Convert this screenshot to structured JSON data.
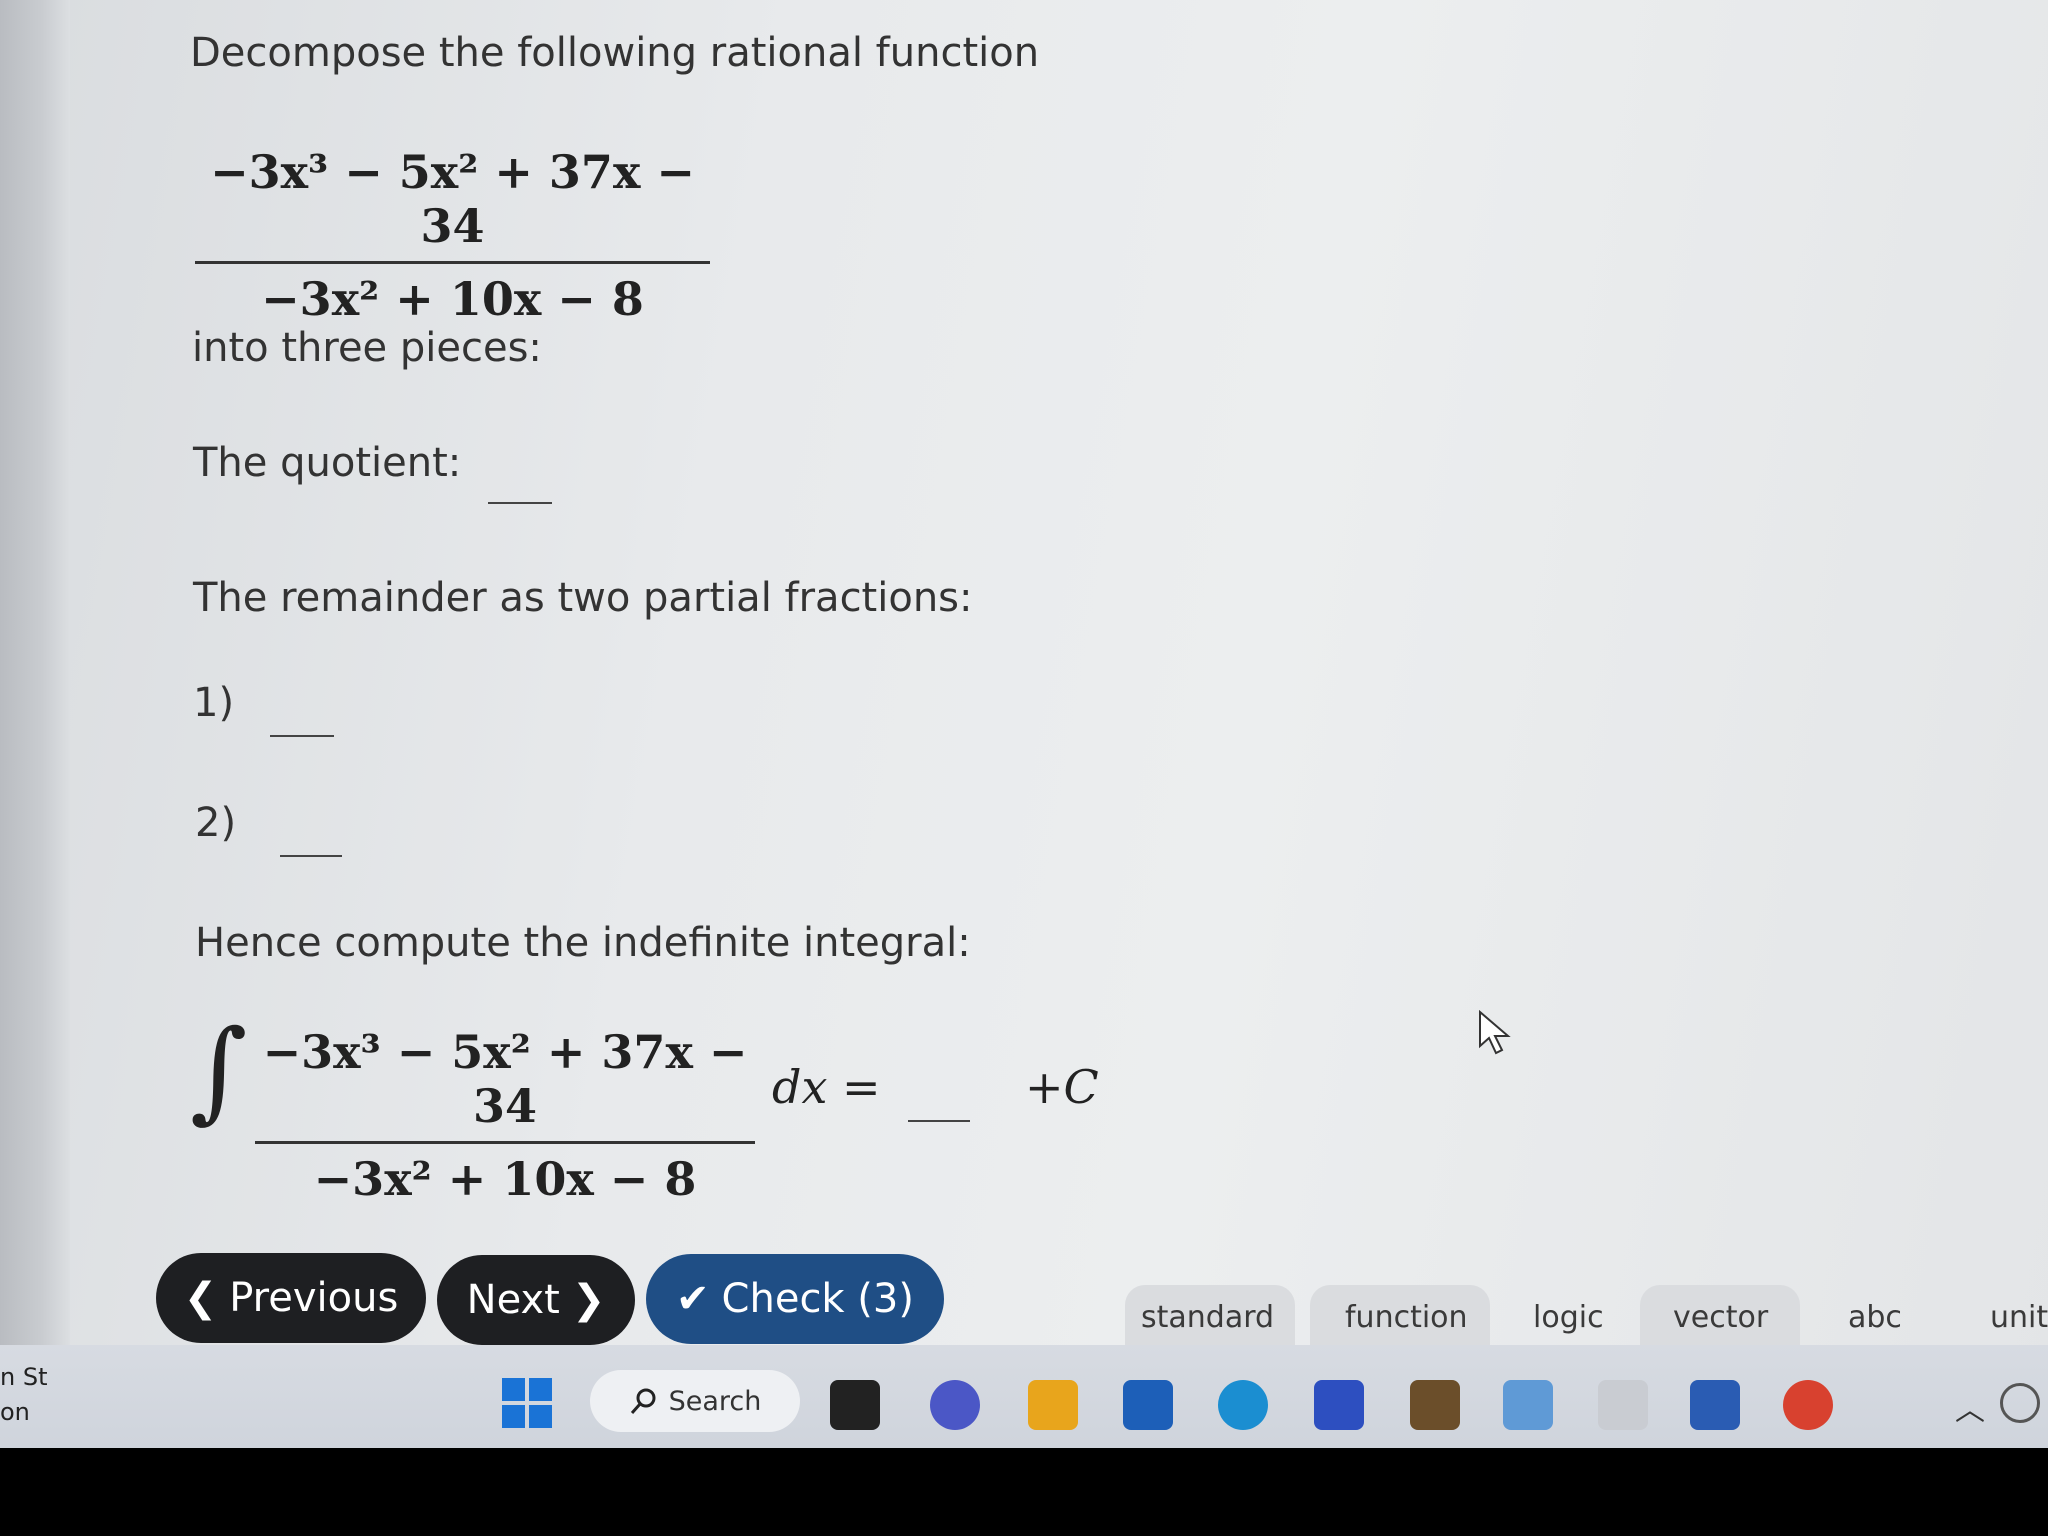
{
  "problem": {
    "intro": "Decompose the following rational function",
    "numerator": "−3x³ − 5x² + 37x − 34",
    "denominator": "−3x² + 10x − 8",
    "into_text": "into three pieces:",
    "quotient_label": "The quotient:",
    "remainder_label": "The remainder as two partial fractions:",
    "item1_label": "1)",
    "item2_label": "2)",
    "integral_intro": "Hence compute the indefinite integral:",
    "integral_sign": "∫",
    "dx_equals": "dx =",
    "plus_c": "+C"
  },
  "buttons": {
    "previous": "Previous",
    "next": "Next",
    "check": "Check (3)"
  },
  "palette_tabs": [
    "standard",
    "function",
    "logic",
    "vector",
    "abc",
    "unit"
  ],
  "taskbar": {
    "search_label": "Search",
    "left_edge_line1": "n St",
    "left_edge_line2": "on"
  },
  "colors": {
    "check_button": "#1f4e85",
    "nav_button": "#1e1f22"
  }
}
